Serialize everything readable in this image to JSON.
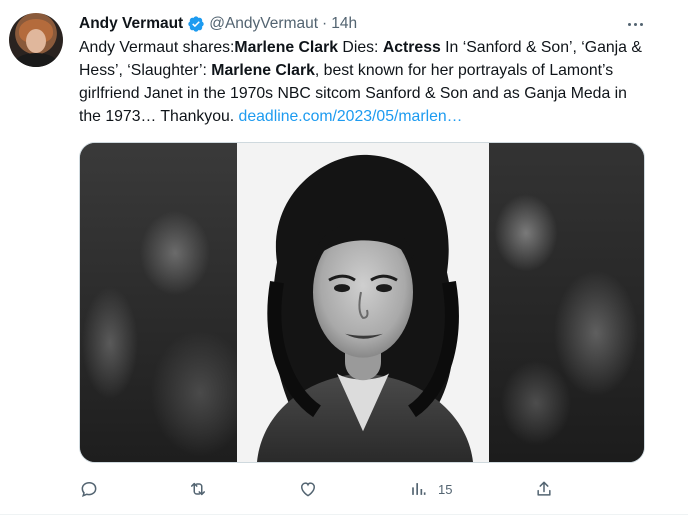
{
  "tweet": {
    "author_name": "Andy Vermaut",
    "handle": "@AndyVermaut",
    "separator": "·",
    "time": "14h",
    "segments": [
      {
        "text": "Andy Vermaut shares:",
        "style": "normal"
      },
      {
        "text": "Marlene Clark",
        "style": "bold"
      },
      {
        "text": " Dies: ",
        "style": "normal"
      },
      {
        "text": "Actress",
        "style": "bold"
      },
      {
        "text": " In ‘Sanford & Son’, ‘Ganja & Hess’, ‘Slaughter’: ",
        "style": "normal"
      },
      {
        "text": "Marlene Clark",
        "style": "bold"
      },
      {
        "text": ", best known for her portrayals of Lamont’s girlfriend Janet in the 1970s NBC sitcom Sanford & Son and as Ganja Meda in the 1973… Thankyou. ",
        "style": "normal"
      },
      {
        "text": "deadline.com/2023/05/marlen…",
        "style": "link"
      }
    ],
    "actions": {
      "reply_icon": "reply-icon",
      "retweet_icon": "retweet-icon",
      "like_icon": "like-icon",
      "views_icon": "views-icon",
      "views_count": "15",
      "share_icon": "share-icon"
    },
    "colors": {
      "link": "#1d9bf0",
      "verified": "#1d9bf0",
      "secondary_text": "#536471"
    }
  }
}
